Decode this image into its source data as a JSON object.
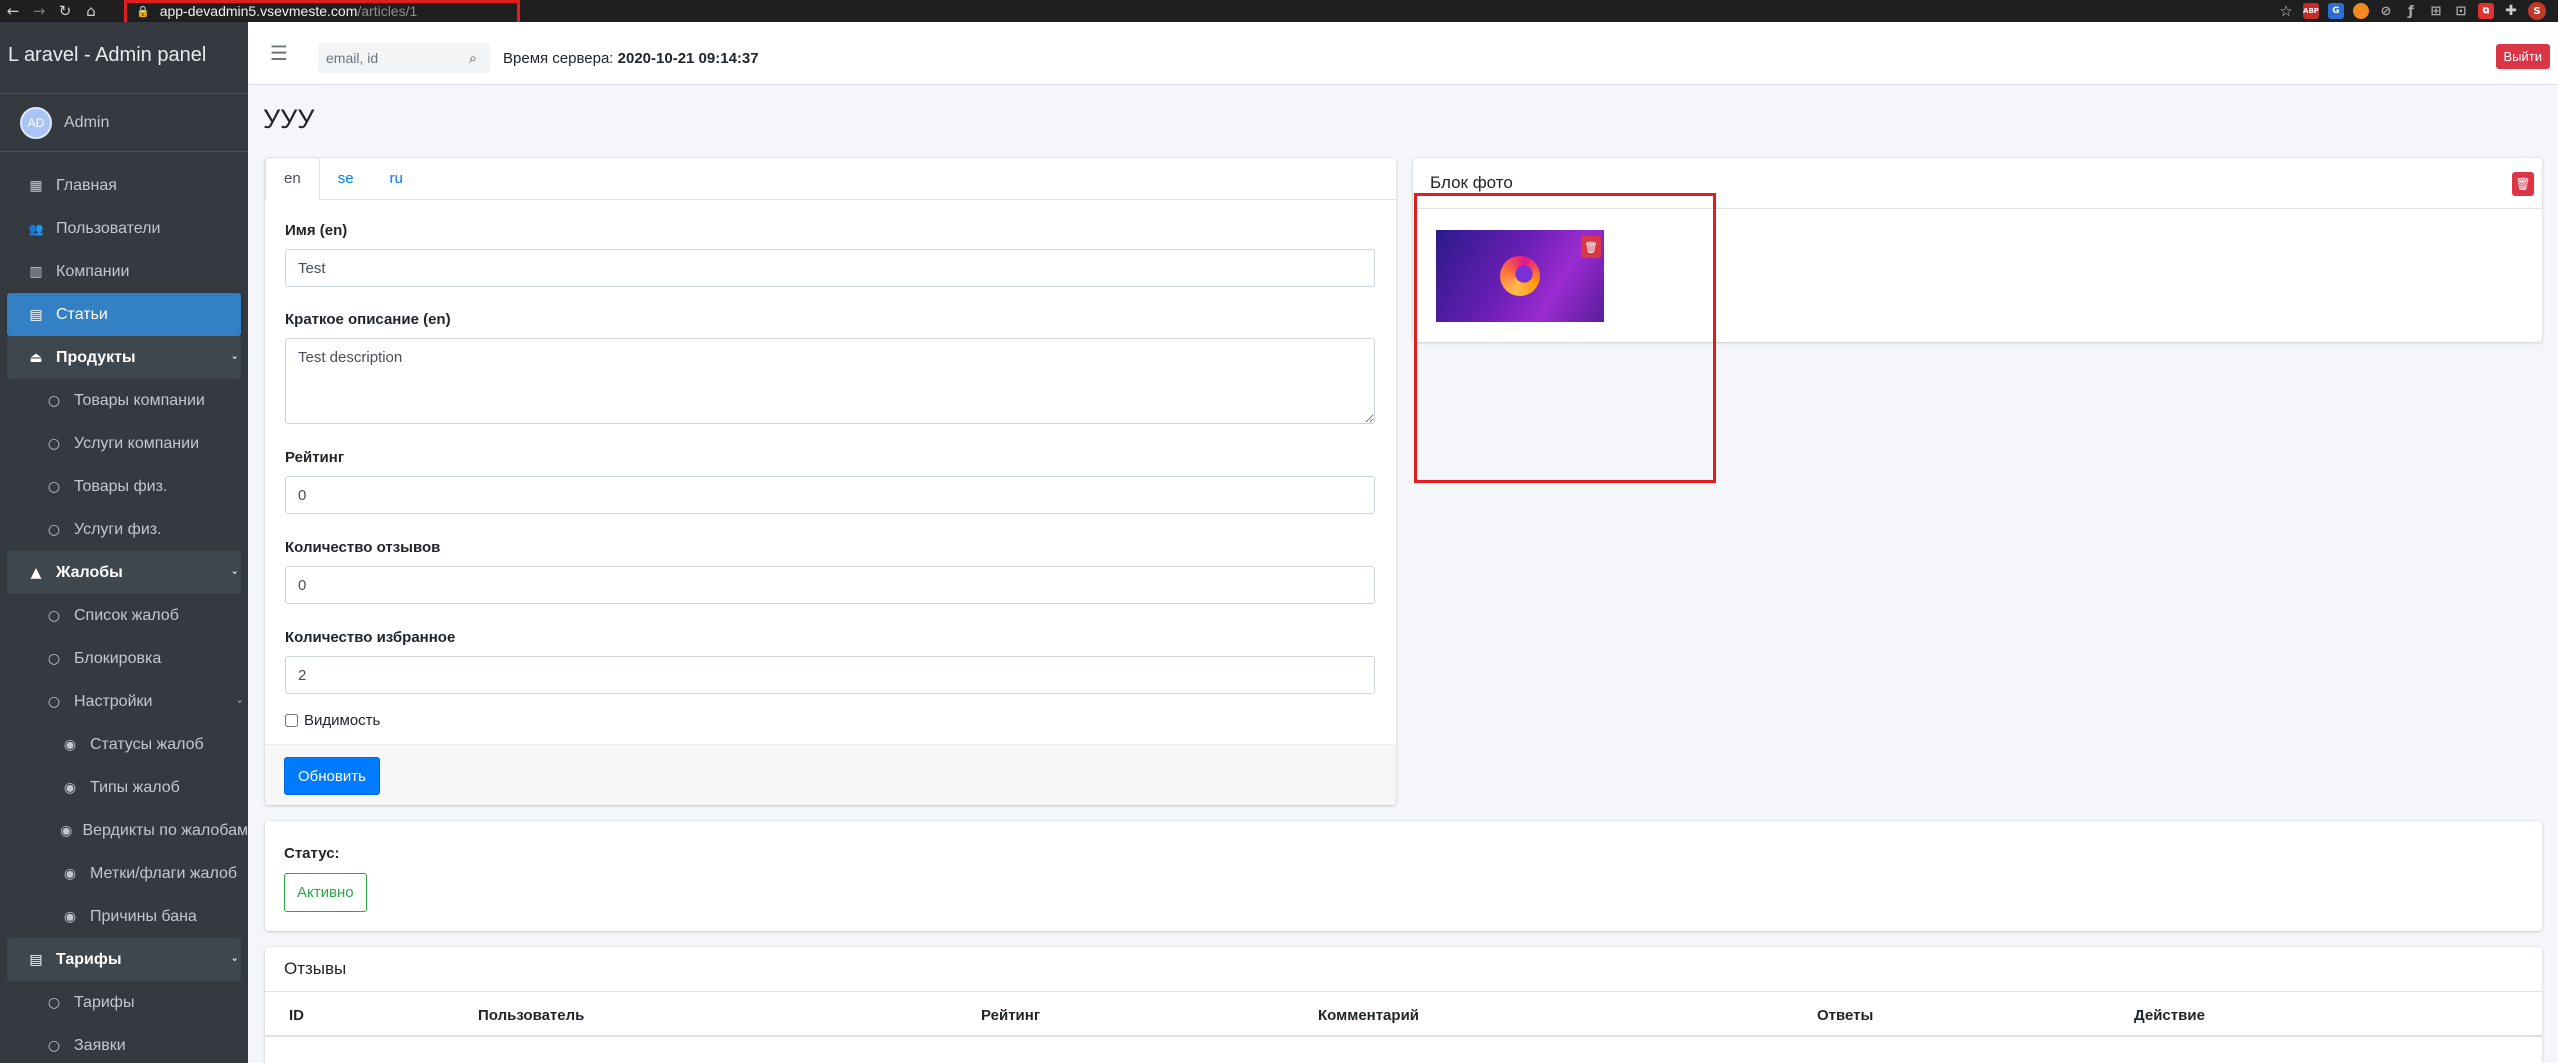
{
  "browser": {
    "url_host": "app-devadmin5.vsevmeste.com",
    "url_path": "/articles/1",
    "extensions": [
      {
        "name": "star-icon",
        "glyph": "☆"
      },
      {
        "name": "adblock-icon",
        "glyph": "ABP"
      },
      {
        "name": "translate-icon",
        "glyph": "G"
      },
      {
        "name": "orange-extension-icon",
        "glyph": "●"
      },
      {
        "name": "link-extension-icon",
        "glyph": "⊘"
      },
      {
        "name": "font-extension-icon",
        "glyph": "ƒ"
      },
      {
        "name": "scissors-extension-icon",
        "glyph": "⊞"
      },
      {
        "name": "crop-extension-icon",
        "glyph": "⊡"
      },
      {
        "name": "red-extension-icon",
        "glyph": "⧉"
      },
      {
        "name": "extensions-puzzle-icon",
        "glyph": "✚"
      },
      {
        "name": "profile-avatar",
        "glyph": "S"
      }
    ]
  },
  "sidebar": {
    "brand": "L aravel - Admin panel",
    "user": {
      "initials": "AD",
      "name": "Admin"
    },
    "items": [
      {
        "label": "Главная",
        "icon": "▦"
      },
      {
        "label": "Пользователи",
        "icon": "👥"
      },
      {
        "label": "Компании",
        "icon": "▥"
      },
      {
        "label": "Статьи",
        "icon": "▤"
      },
      {
        "label": "Продукты",
        "icon": "⏏"
      },
      {
        "label": "Товары компании",
        "icon": "○"
      },
      {
        "label": "Услуги компании",
        "icon": "○"
      },
      {
        "label": "Товары физ.",
        "icon": "○"
      },
      {
        "label": "Услуги физ.",
        "icon": "○"
      },
      {
        "label": "Жалобы",
        "icon": "▲"
      },
      {
        "label": "Список жалоб",
        "icon": "○"
      },
      {
        "label": "Блокировка",
        "icon": "○"
      },
      {
        "label": "Настройки",
        "icon": "○"
      },
      {
        "label": "Статусы жалоб",
        "icon": "◉"
      },
      {
        "label": "Типы жалоб",
        "icon": "◉"
      },
      {
        "label": "Вердикты по жалобам",
        "icon": "◉"
      },
      {
        "label": "Метки/флаги жалоб",
        "icon": "◉"
      },
      {
        "label": "Причины бана",
        "icon": "◉"
      },
      {
        "label": "Тарифы",
        "icon": "▤"
      },
      {
        "label": "Тарифы",
        "icon": "○"
      },
      {
        "label": "Заявки",
        "icon": "○"
      }
    ],
    "chevron": "‹"
  },
  "topbar": {
    "search_placeholder": "email, id",
    "server_time_label": "Время сервера:",
    "server_time_value": "2020-10-21 09:14:37",
    "logout_label": "Выйти"
  },
  "page": {
    "title": "УУУ",
    "tabs": [
      "en",
      "se",
      "ru"
    ],
    "fields": {
      "name_label": "Имя (en)",
      "name_value": "Test",
      "desc_label": "Краткое описание (en)",
      "desc_value": "Test description",
      "rating_label": "Рейтинг",
      "rating_value": "0",
      "reviews_count_label": "Количество отзывов",
      "reviews_count_value": "0",
      "favorites_label": "Количество избранное",
      "favorites_value": "2",
      "visibility_label": "Видимость"
    },
    "update_button": "Обновить",
    "photo_block": {
      "title": "Блок фото"
    },
    "status": {
      "label": "Статус:",
      "value": "Активно"
    },
    "reviews": {
      "title": "Отзывы",
      "columns": [
        "ID",
        "Пользователь",
        "Рейтинг",
        "Комментарий",
        "Ответы",
        "Действие"
      ]
    }
  },
  "colors": {
    "sidebar_bg": "#343a40",
    "active_item": "#3480c4",
    "primary": "#007bff",
    "danger": "#dc3545",
    "success": "#28a745",
    "highlight": "#e01e1e"
  }
}
